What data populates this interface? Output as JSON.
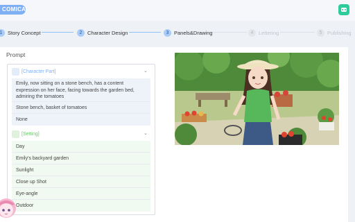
{
  "app": {
    "logo_text": "COMICAI"
  },
  "header": {
    "icon": "robot-icon",
    "accent": "#7fb0f4",
    "icon_color": "#2ecc9a"
  },
  "steps": [
    {
      "number": "1",
      "label": "Story Concept",
      "active": true
    },
    {
      "number": "2",
      "label": "Character Design",
      "active": true
    },
    {
      "number": "3",
      "label": "Panels&Drawing",
      "active": true
    },
    {
      "number": "4",
      "label": "Lettering",
      "active": false
    },
    {
      "number": "5",
      "label": "Publishing",
      "active": false
    }
  ],
  "prompt": {
    "label": "Prompt",
    "character_part": {
      "title": "[Character Part]",
      "rows": [
        "Emily, now sitting on a stone bench, has a content expression on her face, facing towards the garden bed, admiring the tomatoes",
        "Stone bench, basket of tomatoes",
        "None"
      ],
      "color": "#7fb0f4"
    },
    "setting": {
      "title": "[Setting]",
      "rows": [
        "Day",
        "Emily's backyard garden",
        "Sunlight",
        "Close up Shot",
        "Eye-angle",
        "Outdoor"
      ],
      "color": "#6cc56c"
    }
  }
}
